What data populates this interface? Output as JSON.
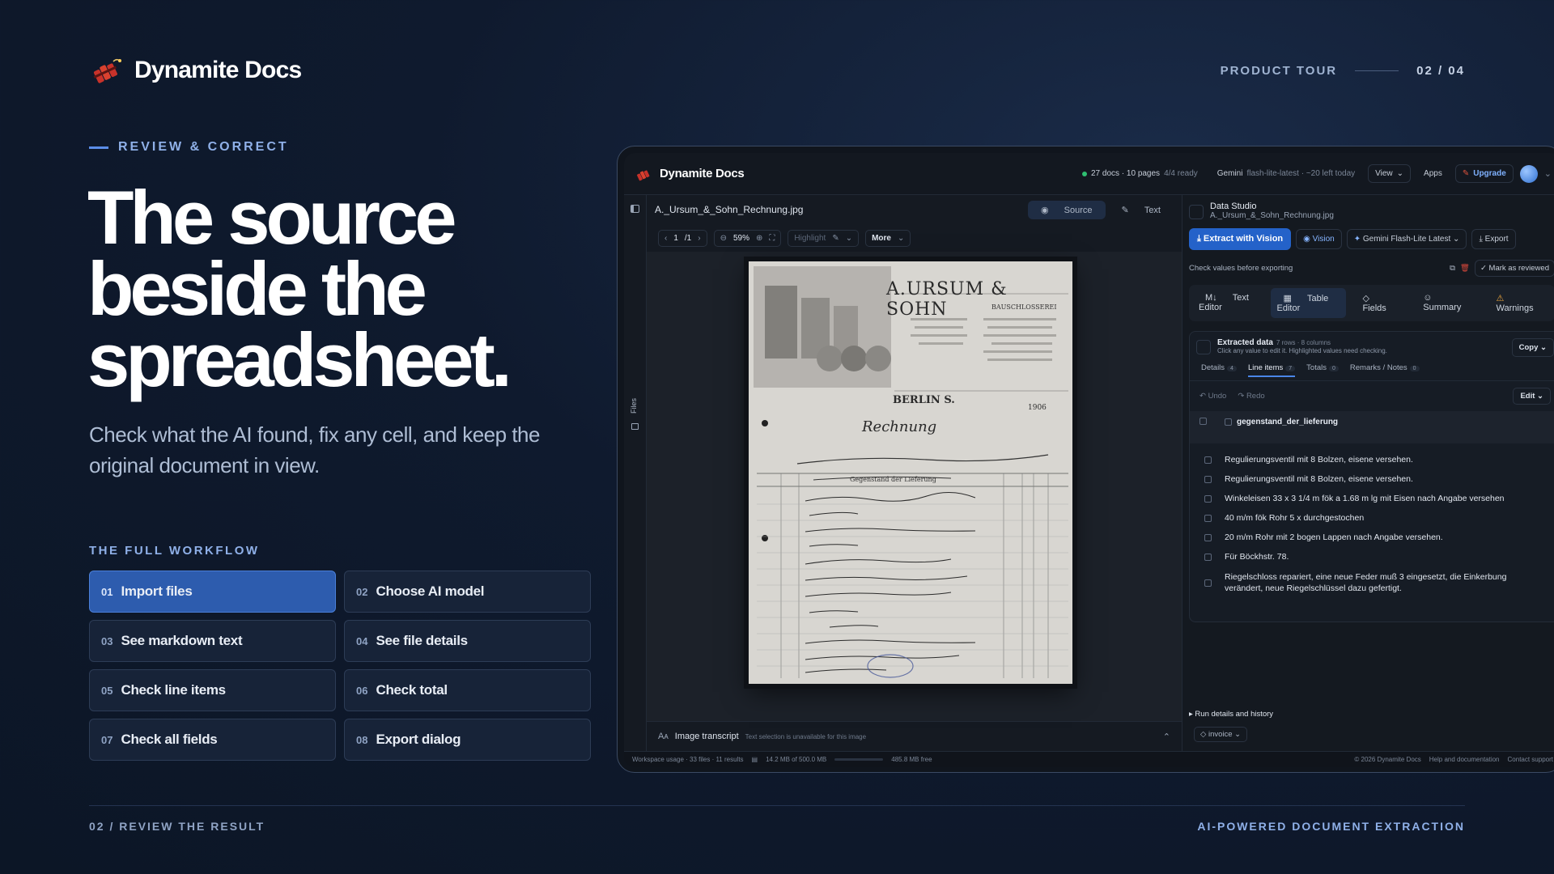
{
  "brand": {
    "name": "Dynamite Docs"
  },
  "tour": {
    "label": "PRODUCT TOUR",
    "count": "02 / 04"
  },
  "eyebrow": "REVIEW & CORRECT",
  "headline": "The source beside the spreadsheet.",
  "subhead": "Check what the AI found, fix any cell, and keep the original document in view.",
  "workflow": {
    "title": "THE FULL WORKFLOW",
    "steps": [
      {
        "num": "01",
        "label": "Import files",
        "active": true
      },
      {
        "num": "02",
        "label": "Choose AI model"
      },
      {
        "num": "03",
        "label": "See markdown text"
      },
      {
        "num": "04",
        "label": "See file details"
      },
      {
        "num": "05",
        "label": "Check line items"
      },
      {
        "num": "06",
        "label": "Check total"
      },
      {
        "num": "07",
        "label": "Check all fields"
      },
      {
        "num": "08",
        "label": "Export dialog"
      }
    ]
  },
  "footer": {
    "left": "02 / REVIEW THE RESULT",
    "right": "AI-POWERED DOCUMENT EXTRACTION"
  },
  "app": {
    "name": "Dynamite Docs",
    "status": "27 docs · 10 pages",
    "ready": "4/4 ready",
    "model_name": "Gemini",
    "model_detail": "flash-lite-latest · ~20 left today",
    "view": "View",
    "apps": "Apps",
    "upgrade": "Upgrade",
    "file_name": "A._Ursum_&_Sohn_Rechnung.jpg",
    "source_tab": "Source",
    "text_tab": "Text",
    "page_current": "1",
    "page_total": "/1",
    "zoom": "59%",
    "highlight": "Highlight",
    "more": "More",
    "rail_label": "Files",
    "transcript_title": "Image transcript",
    "transcript_note": "Text selection is unavailable for this image",
    "data_studio": "Data Studio",
    "data_studio_file": "A._Ursum_&_Sohn_Rechnung.jpg",
    "extract_button": "Extract with Vision",
    "vision": "Vision",
    "model_select": "Gemini Flash-Lite Latest",
    "export": "Export",
    "check_note": "Check values before exporting",
    "mark_reviewed": "Mark as reviewed",
    "tabs": [
      "Text Editor",
      "Table Editor",
      "Fields",
      "Summary",
      "Warnings"
    ],
    "extracted_title": "Extracted data",
    "extracted_meta": "7 rows · 8 columns",
    "extracted_help": "Click any value to edit it. Highlighted values need checking.",
    "copy": "Copy",
    "subtabs": [
      {
        "label": "Details",
        "count": "4"
      },
      {
        "label": "Line items",
        "count": "7"
      },
      {
        "label": "Totals",
        "count": "0"
      },
      {
        "label": "Remarks / Notes",
        "count": "0"
      }
    ],
    "undo": "Undo",
    "redo": "Redo",
    "edit": "Edit",
    "column": "gegenstand_der_lieferung",
    "rows": [
      "Regulierungsventil mit 8 Bolzen, eisene versehen.",
      "Regulierungsventil mit 8 Bolzen, eisene versehen.",
      "Winkeleisen 33 x 3 1/4 m fök a 1.68 m lg mit Eisen nach Angabe versehen",
      "40 m/m fök Rohr 5 x durchgestochen",
      "20 m/m Rohr mit 2 bogen Lappen nach Angabe versehen.",
      "Für Böckhstr. 78.",
      "Riegelschloss repariert, eine neue Feder muß 3 eingesetzt, die Einkerbung verändert, neue Riegelschlüssel dazu gefertigt."
    ],
    "run_details": "Run details and history",
    "invoice_tag": "invoice",
    "workspace_usage": "Workspace usage · 33 files · 11 results",
    "storage": "14.2 MB of 500.0 MB",
    "free": "485.8 MB free",
    "copyright": "© 2026 Dynamite Docs",
    "help": "Help and documentation",
    "contact": "Contact support"
  },
  "document": {
    "company": "A.URSUM & SOHN",
    "tagline": "BAUSCHLOSSEREI",
    "city": "BERLIN S.",
    "year": "1906",
    "title": "Rechnung",
    "column": "Gegenstand der Lieferung"
  },
  "colors": {
    "accent": "#2d5cae",
    "brand_red": "#d23a2c",
    "link_blue": "#86b4ff"
  }
}
